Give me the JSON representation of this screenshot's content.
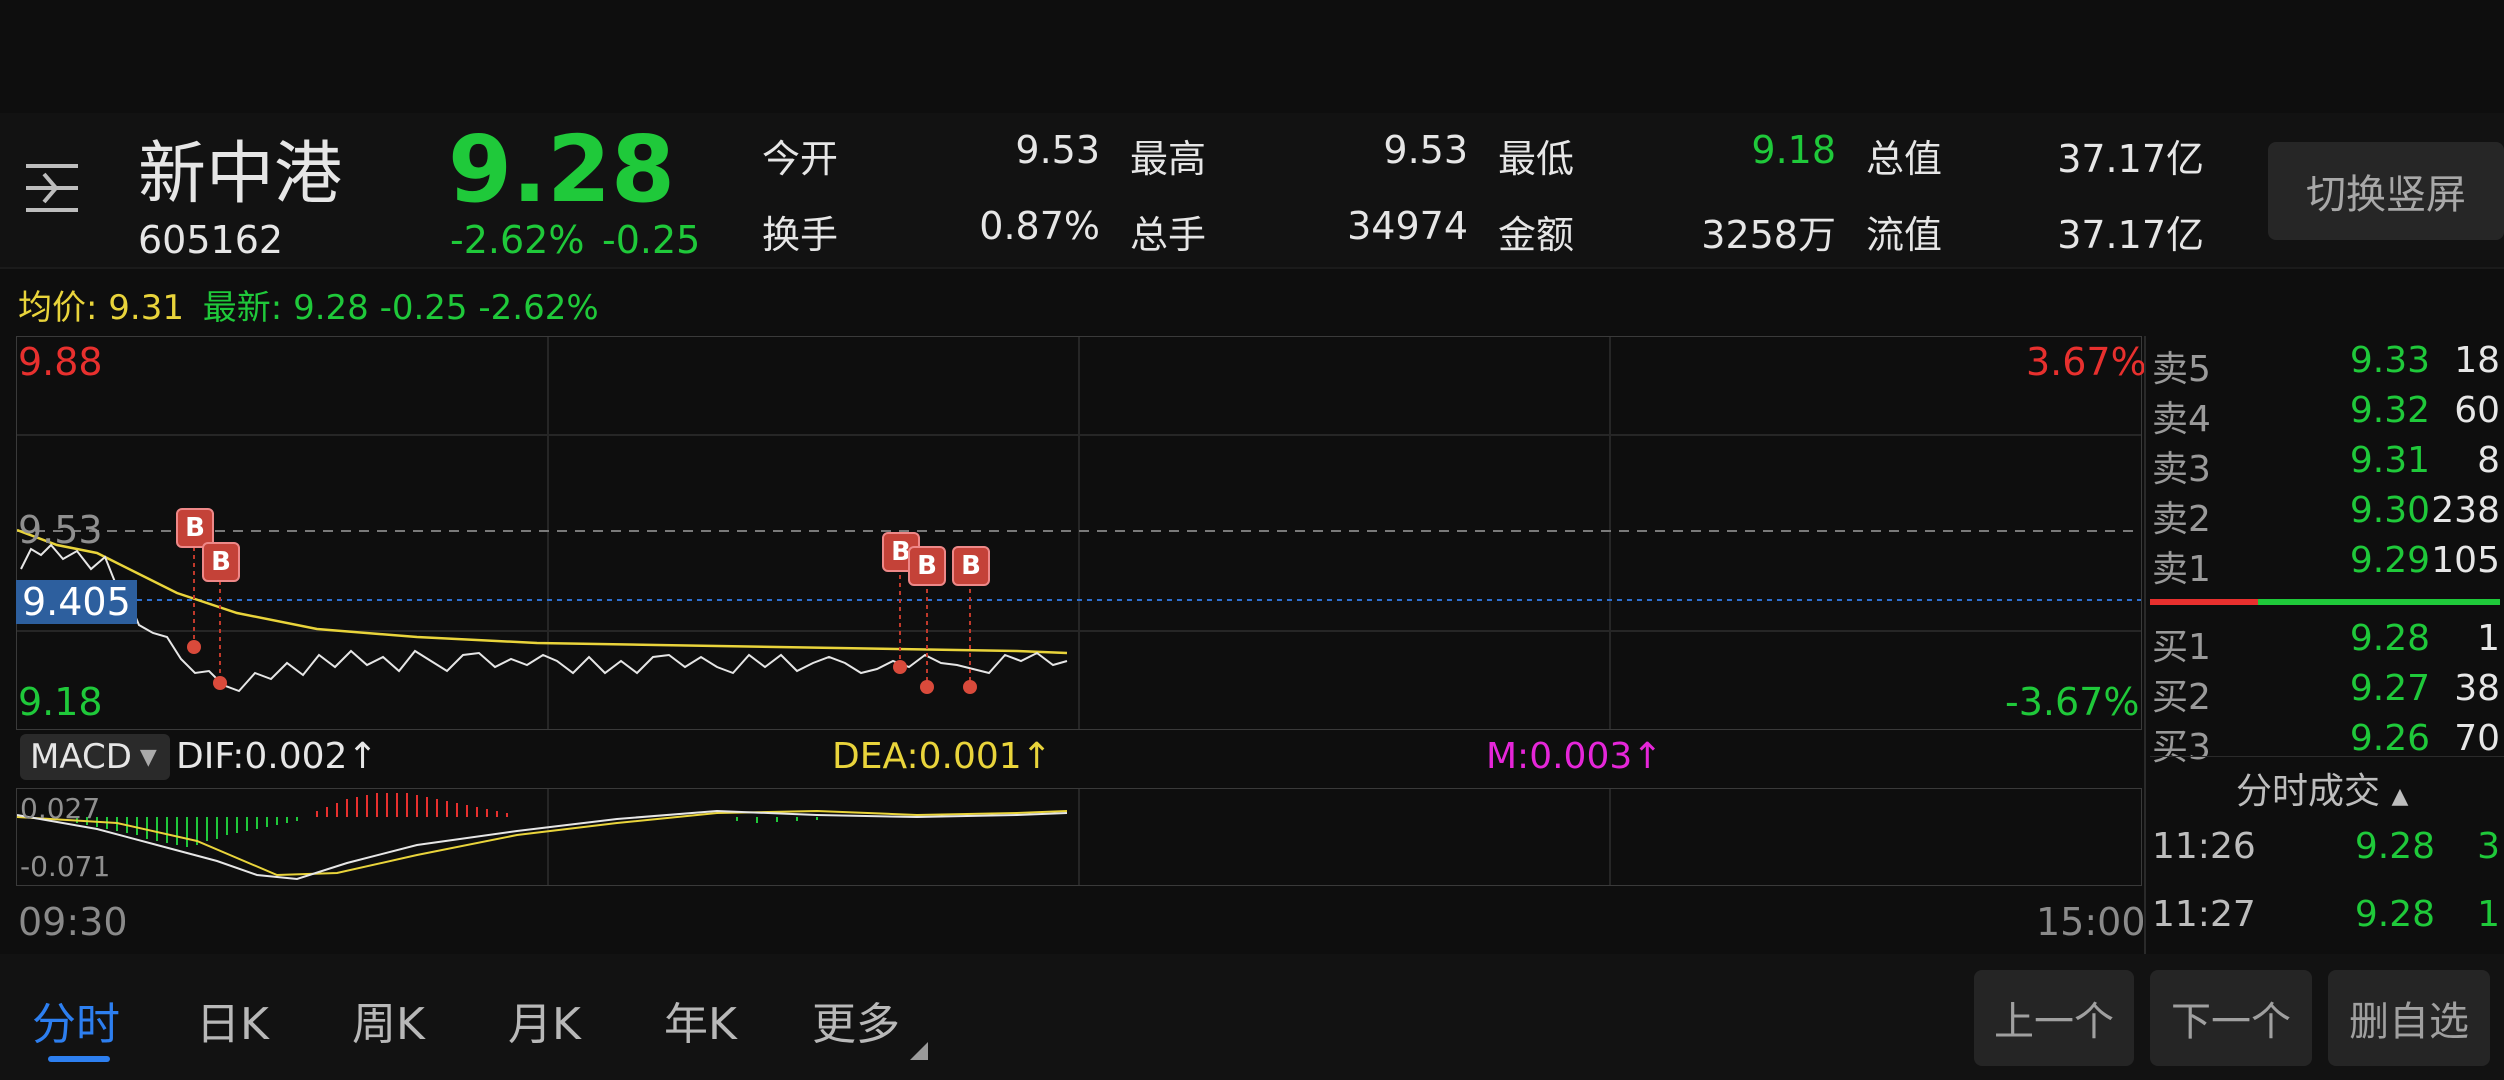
{
  "stock": {
    "name": "新中港",
    "code": "605162",
    "price": "9.28",
    "change_pct": "-2.62%",
    "change_abs": "-0.25"
  },
  "stats": [
    {
      "label": "今开",
      "value": "9.53",
      "color": "#e6e6e6"
    },
    {
      "label": "最高",
      "value": "9.53",
      "color": "#e6e6e6"
    },
    {
      "label": "最低",
      "value": "9.18",
      "color": "#1fc93a"
    },
    {
      "label": "总值",
      "value": "37.17亿",
      "color": "#e6e6e6"
    },
    {
      "label": "换手",
      "value": "0.87%",
      "color": "#e6e6e6"
    },
    {
      "label": "总手",
      "value": "34974",
      "color": "#e6e6e6"
    },
    {
      "label": "金额",
      "value": "3258万",
      "color": "#e6e6e6"
    },
    {
      "label": "流值",
      "value": "37.17亿",
      "color": "#e6e6e6"
    }
  ],
  "switch_label": "切换竖屏",
  "avg_line": {
    "avg_label": "均价:",
    "avg_value": "9.31",
    "latest_label": "最新:",
    "latest_value": "9.28",
    "latest_change": "-0.25",
    "latest_pct": "-2.62%"
  },
  "chart": {
    "y_top": "9.88",
    "y_bottom": "9.18",
    "pct_top": "3.67%",
    "pct_bottom": "-3.67%",
    "ref_price": "9.53",
    "cursor_price": "9.405",
    "time_start": "09:30",
    "time_end": "15:00",
    "marker_label": "B"
  },
  "macd": {
    "selector": "MACD",
    "dif": "DIF:0.002↑",
    "dea": "DEA:0.001↑",
    "m": "M:0.003↑",
    "top": "0.027",
    "bottom": "-0.071"
  },
  "orderbook": {
    "asks": [
      {
        "label": "卖5",
        "price": "9.33",
        "vol": "18"
      },
      {
        "label": "卖4",
        "price": "9.32",
        "vol": "60"
      },
      {
        "label": "卖3",
        "price": "9.31",
        "vol": "8"
      },
      {
        "label": "卖2",
        "price": "9.30",
        "vol": "238"
      },
      {
        "label": "卖1",
        "price": "9.29",
        "vol": "105"
      }
    ],
    "bids": [
      {
        "label": "买1",
        "price": "9.28",
        "vol": "1"
      },
      {
        "label": "买2",
        "price": "9.27",
        "vol": "38"
      },
      {
        "label": "买3",
        "price": "9.26",
        "vol": "70"
      }
    ],
    "trades_title": "分时成交",
    "trades": [
      {
        "time": "11:26",
        "price": "9.28",
        "vol": "3"
      },
      {
        "time": "11:27",
        "price": "9.28",
        "vol": "1"
      }
    ]
  },
  "tabs": [
    {
      "label": "分时",
      "active": true
    },
    {
      "label": "日K"
    },
    {
      "label": "周K"
    },
    {
      "label": "月K"
    },
    {
      "label": "年K"
    },
    {
      "label": "更多"
    }
  ],
  "buttons": {
    "prev": "上一个",
    "next": "下一个",
    "remove": "删自选"
  }
}
